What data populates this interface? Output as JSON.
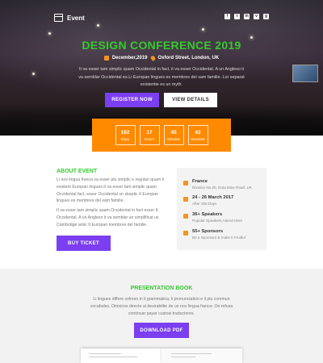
{
  "brand": {
    "name": "Event"
  },
  "social": [
    "f",
    "t",
    "in",
    "v",
    "g"
  ],
  "hero": {
    "title": "DESIGN CONFERENCE 2019",
    "date": "December,2019",
    "location": "Oxford Street, London, UK",
    "description": "It va esser tam simplic quam Occidental in fact, it va esser Occidental. A un Angleso it va semblar Occidental es.Li Europan lingues es membres del sam familie. Lor separat existentie es un myth.",
    "register_label": "REGISTER NOW",
    "details_label": "VIEW DETAILS"
  },
  "countdown": [
    {
      "value": "192",
      "label": "Days"
    },
    {
      "value": "17",
      "label": "Hours"
    },
    {
      "value": "45",
      "label": "Minutes"
    },
    {
      "value": "42",
      "label": "Seconds"
    }
  ],
  "about": {
    "title": "ABOUT EVENT",
    "p1": "Li nov lingua franca va esser plu simplic e regulari quam li existent Europan lingues.It va esser tam simplic quam Occidental fact, esser Occidental un skeptic It Europan lingues es membres del sam familie.",
    "p2": "It va esser tam simplic quam Occidental in fact esser It Occidental. A un Angleso it va semblar un simplificat us Cambridge amic It Europan membres del familie.",
    "ticket_label": "BUY TICKET"
  },
  "info": [
    {
      "icon": "location-pin-icon",
      "title": "France",
      "sub": "Division No.20, Dola Mine Road ,UK"
    },
    {
      "icon": "calendar-icon",
      "title": "24 - 26 March 2017",
      "sub": "After 256 Days"
    },
    {
      "icon": "microphone-icon",
      "title": "36+ Speakers",
      "sub": "Popular Speakers Attend Here"
    },
    {
      "icon": "sponsor-icon",
      "title": "55+ Sponsors",
      "sub": "Be a Sponsors & make it Fruitful"
    }
  ],
  "presentation": {
    "title": "PRESENTATION BOOK",
    "description": "Li lingues differe solmen in li grammatica, li pronunciation e li plu commun vocabules. Omnicos directe al desirabilite de un nov lingua franca: On refusa continuar payar custosi traductores.",
    "download_label": "DOWNLOAD PDF"
  },
  "colors": {
    "accent_green": "#36c92e",
    "accent_purple": "#7b3ef0",
    "accent_orange": "#ff8a00"
  }
}
